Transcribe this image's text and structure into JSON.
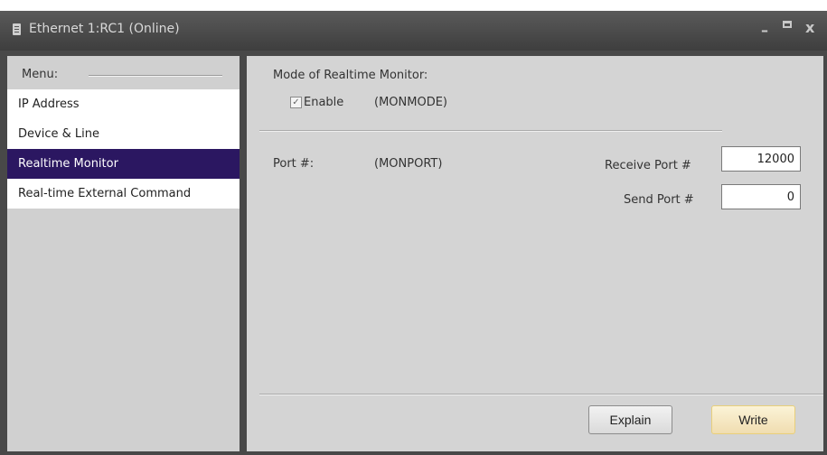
{
  "window": {
    "title": "Ethernet 1:RC1 (Online)",
    "controls": {
      "minimize": "–",
      "close": "x"
    }
  },
  "sidebar": {
    "menu_label": "Menu:",
    "items": [
      {
        "label": "IP Address",
        "selected": false
      },
      {
        "label": "Device & Line",
        "selected": false
      },
      {
        "label": "Realtime Monitor",
        "selected": true
      },
      {
        "label": "Real-time External Command",
        "selected": false
      }
    ],
    "selected_color": "#2b1761"
  },
  "main": {
    "section_title": "Mode of Realtime Monitor:",
    "enable": {
      "label": "Enable",
      "checked": true,
      "check_glyph": "✓"
    },
    "monmode_label": "(MONMODE)",
    "port_label": "Port #:",
    "monport_label": "(MONPORT)",
    "receive_port": {
      "label": "Receive Port #",
      "value": "12000"
    },
    "send_port": {
      "label": "Send Port #",
      "value": "0"
    }
  },
  "buttons": {
    "explain": "Explain",
    "write": "Write"
  }
}
